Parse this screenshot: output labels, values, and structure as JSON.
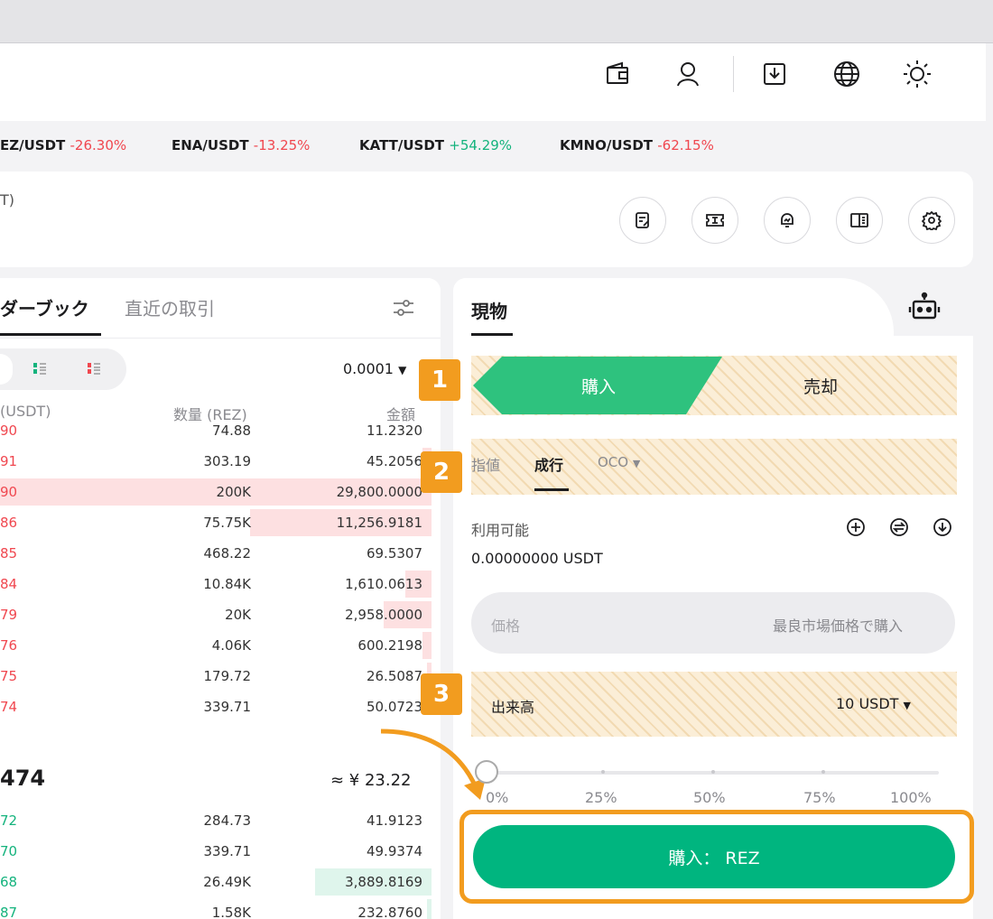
{
  "tickers": [
    {
      "pair": "EZ/USDT",
      "change": "-26.30%",
      "dir": "neg"
    },
    {
      "pair": "ENA/USDT",
      "change": "-13.25%",
      "dir": "neg"
    },
    {
      "pair": "KATT/USDT",
      "change": "+54.29%",
      "dir": "pos"
    },
    {
      "pair": "KMNO/USDT",
      "change": "-62.15%",
      "dir": "neg"
    }
  ],
  "toolbar": {
    "partial_label": "T)"
  },
  "orderbook": {
    "tab_active": "ダーブック",
    "tab_recent": "直近の取引",
    "precision": "0.0001",
    "col_price": "(USDT)",
    "col_qty": "数量 (REZ)",
    "col_amount": "金額",
    "asks": [
      {
        "price": "90",
        "qty": "74.88",
        "amount": "11.2320",
        "fill": 0.0
      },
      {
        "price": "91",
        "qty": "303.19",
        "amount": "45.2056",
        "fill": 0.02
      },
      {
        "price": "90",
        "qty": "200K",
        "amount": "29,800.0000",
        "fill": 1.0
      },
      {
        "price": "86",
        "qty": "75.75K",
        "amount": "11,256.9181",
        "fill": 0.42
      },
      {
        "price": "85",
        "qty": "468.22",
        "amount": "69.5307",
        "fill": 0.0
      },
      {
        "price": "84",
        "qty": "10.84K",
        "amount": "1,610.0613",
        "fill": 0.06
      },
      {
        "price": "79",
        "qty": "20K",
        "amount": "2,958.0000",
        "fill": 0.11
      },
      {
        "price": "76",
        "qty": "4.06K",
        "amount": "600.2198",
        "fill": 0.02
      },
      {
        "price": "75",
        "qty": "179.72",
        "amount": "26.5087",
        "fill": 0.01
      },
      {
        "price": "74",
        "qty": "339.71",
        "amount": "50.0723",
        "fill": 0.0
      }
    ],
    "last_price": "474",
    "last_price_fiat": "≈ ¥ 23.22",
    "bids": [
      {
        "price": "72",
        "qty": "284.73",
        "amount": "41.9123",
        "fill": 0.0
      },
      {
        "price": "70",
        "qty": "339.71",
        "amount": "49.9374",
        "fill": 0.0
      },
      {
        "price": "68",
        "qty": "26.49K",
        "amount": "3,889.8169",
        "fill": 0.27
      },
      {
        "price": "87",
        "qty": "1.58K",
        "amount": "232.8760",
        "fill": 0.01
      }
    ]
  },
  "spot": {
    "tab": "現物",
    "buy": "購入",
    "sell": "売却",
    "order_types": [
      "指値",
      "成行",
      "OCO"
    ],
    "active_order_type": "成行",
    "available_label": "利用可能",
    "available_value": "0.00000000 USDT",
    "price_label": "価格",
    "price_placeholder": "最良市場価格で購入",
    "volume_label": "出来高",
    "volume_value": "10 USDT",
    "slider_percent": 0,
    "slider_labels": [
      "0%",
      "25%",
      "50%",
      "75%",
      "100%"
    ],
    "buy_button": "購入： REZ"
  },
  "steps": [
    "1",
    "2",
    "3"
  ],
  "colors": {
    "buy": "#00b57f",
    "sell_red": "#f0474f",
    "step_orange": "#f29c1f"
  }
}
